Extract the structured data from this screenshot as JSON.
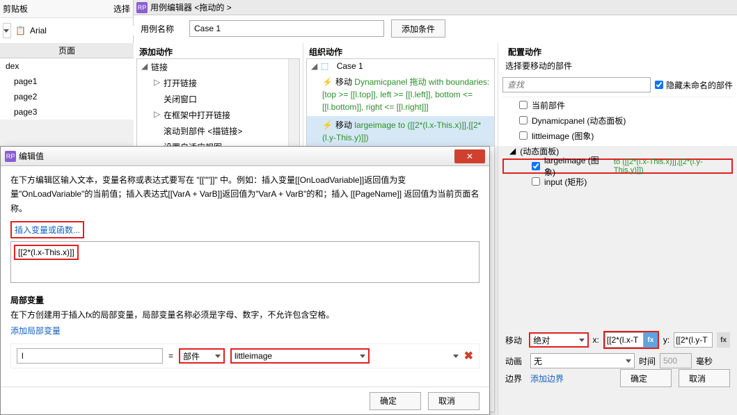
{
  "topbar": {
    "clipboard": "剪贴板",
    "select": "选择",
    "font": "Arial"
  },
  "pages": {
    "header": "页面",
    "index": "dex",
    "items": [
      "page1",
      "page2",
      "page3"
    ]
  },
  "caseEditor": {
    "title": "用例编辑器 <拖动的 >",
    "caseNameLabel": "用例名称",
    "caseName": "Case 1",
    "addCondition": "添加条件"
  },
  "addActions": {
    "header": "添加动作",
    "group": "链接",
    "items": [
      "打开链接",
      "关闭窗口",
      "在框架中打开链接",
      "滚动到部件 <描链接>",
      "设置自适应视图"
    ]
  },
  "orgActions": {
    "header": "组织动作",
    "caseName": "Case 1",
    "action1_prefix": "移动 ",
    "action1_green": "Dynamicpanel 拖动 with boundaries: [top >= [[l.top]], left >= [[l.left]], bottom <= [[l.bottom]], right <= [[l.right]]]",
    "action2_prefix": "移动 ",
    "action2_green": "largeimage to ([[2*(l.x-This.x)]],[[2*(l.y-This.y)]])"
  },
  "config": {
    "header": "配置动作",
    "selectLabel": "选择要移动的部件",
    "searchPlaceholder": "查找",
    "hideUnnamed": "隐藏未命名的部件",
    "widgets": {
      "w0": "当前部件",
      "w1": "Dynamicpanel (动态面板)",
      "w2": "littleimage (图象)",
      "w3": "(动态面板)",
      "w4": "largeimage (图象)",
      "w4_green": " to ([[2*(l.x-This.x)]],[[2*(l.y-This.y)]])",
      "w5": "input (矩形)"
    },
    "moveLabel": "移动",
    "moveType": "绝对",
    "xLabel": "x:",
    "xVal": "[[2*(l.x-T",
    "yLabel": "y:",
    "yVal": "[[2*(l.y-T",
    "fx": "fx",
    "animLabel": "动画",
    "animVal": "无",
    "timeLabel": "时间",
    "timeVal": "500",
    "timeUnit": "毫秒",
    "boundsLabel": "边界",
    "addBounds": "添加边界",
    "ok": "确定",
    "cancel": "取消"
  },
  "dialog": {
    "title": "编辑值",
    "desc": "在下方编辑区输入文本，变量名称或表达式要写在 \"[[\"\"]]\" 中。例如：插入变量[[OnLoadVariable]]返回值为变量\"OnLoadVariable\"的当前值；插入表达式[[VarA + VarB]]返回值为\"VarA + VarB\"的和；插入 [[PageName]] 返回值为当前页面名称。",
    "insertVar": "插入变量或函数...",
    "expression": "[[2*(l.x-This.x)]]",
    "localVarHeader": "局部变量",
    "localVarDesc": "在下方创建用于插入fx的局部变量，局部变量名称必须是字母、数字，不允许包含空格。",
    "addLocalVar": "添加局部变量",
    "lvName": "l",
    "lvEq": "=",
    "lvType": "部件",
    "lvTarget": "littleimage",
    "ok": "确定",
    "cancel": "取消"
  }
}
